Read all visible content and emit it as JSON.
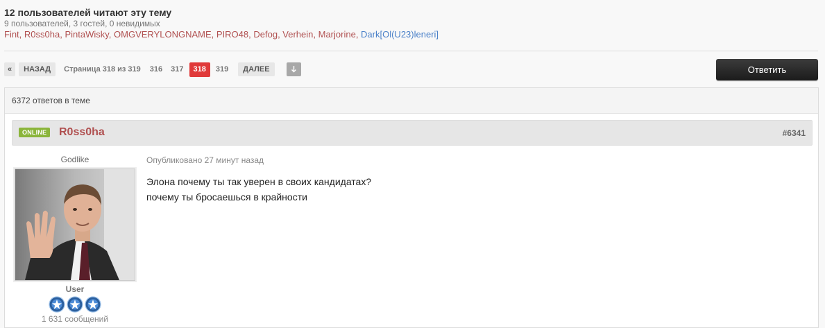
{
  "readers": {
    "title": "12 пользователей читают эту тему",
    "stats": "9 пользователей, 3 гостей, 0 невидимых",
    "users": [
      {
        "name": "Fint",
        "role": "user"
      },
      {
        "name": "R0ss0ha",
        "role": "user"
      },
      {
        "name": "PintaWisky",
        "role": "user"
      },
      {
        "name": "OMGVERYLONGNAME",
        "role": "user"
      },
      {
        "name": "PIRO48",
        "role": "user"
      },
      {
        "name": "Defog",
        "role": "user"
      },
      {
        "name": "Verhein",
        "role": "user"
      },
      {
        "name": "Marjorine",
        "role": "user"
      },
      {
        "name": "Dark[Ol(U23)leneri]",
        "role": "admin"
      }
    ],
    "colors": {
      "user": "#b05050",
      "admin": "#4a80c8"
    }
  },
  "pagination": {
    "first": "«",
    "prev": "НАЗАД",
    "info": "Страница 318 из 319",
    "pages": [
      {
        "label": "316",
        "active": false
      },
      {
        "label": "317",
        "active": false
      },
      {
        "label": "318",
        "active": true
      },
      {
        "label": "319",
        "active": false
      }
    ],
    "next": "ДАЛЕЕ",
    "jump_icon": "arrow-down-icon"
  },
  "reply_button": "Ответить",
  "topic": {
    "reply_count": "6372 ответов в теме"
  },
  "post": {
    "status": "ONLINE",
    "author": "R0ss0ha",
    "number": "#6341",
    "author_title": "Godlike",
    "group": "User",
    "post_count": "1 631 сообщений",
    "published": "Опубликовано 27 минут назад",
    "body": [
      "Элона почему ты так уверен в своих кандидатах?",
      "почему ты бросаешься в крайности"
    ],
    "rank_icons": [
      "rank-star-icon",
      "rank-star-icon",
      "rank-star-icon"
    ]
  },
  "colors": {
    "accent_red": "#e03a3a",
    "online_green": "#8bb53b",
    "author_name": "#b05050"
  }
}
